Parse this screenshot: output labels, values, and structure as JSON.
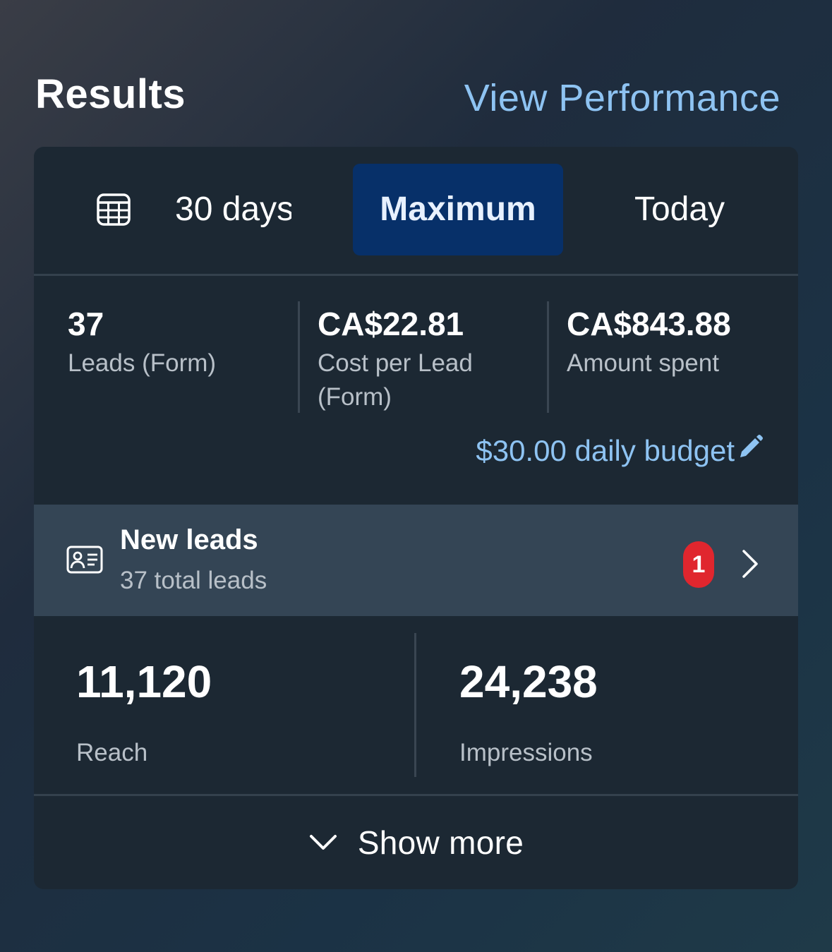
{
  "header": {
    "title": "Results",
    "view_performance": "View Performance"
  },
  "tabs": {
    "calendar_icon": "calendar-icon",
    "items": [
      {
        "label": "30 days"
      },
      {
        "label": "Maximum",
        "selected": true
      },
      {
        "label": "Today"
      }
    ]
  },
  "stats": [
    {
      "value": "37",
      "label": "Leads (Form)"
    },
    {
      "value": "CA$22.81",
      "label": "Cost per Lead (Form)"
    },
    {
      "value": "CA$843.88",
      "label": "Amount spent"
    }
  ],
  "budget": {
    "label": "$30.00 daily budget",
    "icon": "pencil-icon"
  },
  "leads": {
    "title": "New leads",
    "subtitle": "37 total leads",
    "badge": "1",
    "icon": "contact-card-icon"
  },
  "metrics": [
    {
      "value": "11,120",
      "label": "Reach"
    },
    {
      "value": "24,238",
      "label": "Impressions"
    }
  ],
  "show_more": {
    "label": "Show more"
  },
  "colors": {
    "accent_link": "#8ec3f2",
    "selected_tab": "#073069",
    "badge": "#e0262e",
    "card": "#1c2833",
    "leads_row": "#344555"
  }
}
